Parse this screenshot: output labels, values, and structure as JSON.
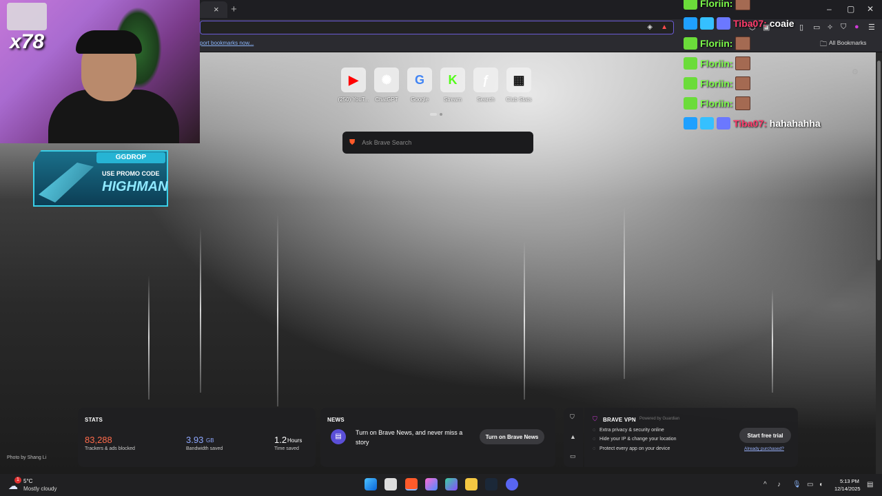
{
  "browser": {
    "tab_close": "×",
    "new_tab": "+",
    "window_controls": [
      "–",
      "▢",
      "✕"
    ],
    "import_bookmarks": "port bookmarks now...",
    "all_bookmarks": "All Bookmarks"
  },
  "stream": {
    "sub_count": "x78",
    "promo": {
      "brand": "GGDROP",
      "line1": "USE PROMO CODE",
      "code": "HIGHMAN"
    }
  },
  "chat": [
    {
      "name": "Floriin:",
      "message": "",
      "type": "f"
    },
    {
      "name": "Tiba07:",
      "message": "coaie",
      "type": "t"
    },
    {
      "name": "Floriin:",
      "message": "",
      "type": "f"
    },
    {
      "name": "Floriin:",
      "message": "",
      "type": "f"
    },
    {
      "name": "Floriin:",
      "message": "",
      "type": "f"
    },
    {
      "name": "Floriin:",
      "message": "",
      "type": "f"
    },
    {
      "name": "Tiba07:",
      "message": "hahahahha",
      "type": "t"
    }
  ],
  "newtab": {
    "tiles": [
      {
        "label": "(250) YouT...",
        "icon": "youtube-icon",
        "glyph": "▶",
        "color": "#ff0000"
      },
      {
        "label": "ChatGPT",
        "icon": "chatgpt-icon",
        "glyph": "✺",
        "color": "#ffffff"
      },
      {
        "label": "Google",
        "icon": "google-icon",
        "glyph": "G",
        "color": "#4285f4"
      },
      {
        "label": "Stream",
        "icon": "kick-icon",
        "glyph": "K",
        "color": "#53fc18"
      },
      {
        "label": "Search",
        "icon": "search-f-icon",
        "glyph": "ƒ",
        "color": "#ffffff"
      },
      {
        "label": "Club Stats",
        "icon": "grid-icon",
        "glyph": "▦",
        "color": "#111111"
      }
    ],
    "search_placeholder": "Ask Brave Search",
    "photo_credit": "Photo by Shang Li"
  },
  "stats": {
    "title": "STATS",
    "trackers_value": "83,288",
    "trackers_label": "Trackers & ads blocked",
    "bandwidth_value": "3.93",
    "bandwidth_unit": "GB",
    "bandwidth_label": "Bandwidth saved",
    "time_value": "1.2",
    "time_unit": "Hours",
    "time_label": "Time saved"
  },
  "news": {
    "title": "NEWS",
    "text": "Turn on Brave News, and never miss a story",
    "button": "Turn on Brave News"
  },
  "vpn": {
    "title": "BRAVE VPN",
    "powered": "Powered by Guardian",
    "features": [
      "Extra privacy & security online",
      "Hide your IP & change your location",
      "Protect every app on your device"
    ],
    "button": "Start free trial",
    "link": "Already purchased?"
  },
  "taskbar": {
    "weather_temp": "5°C",
    "weather_desc": "Mostly cloudy",
    "weather_badge": "1",
    "time": "5:13 PM",
    "date": "12/14/2025"
  }
}
